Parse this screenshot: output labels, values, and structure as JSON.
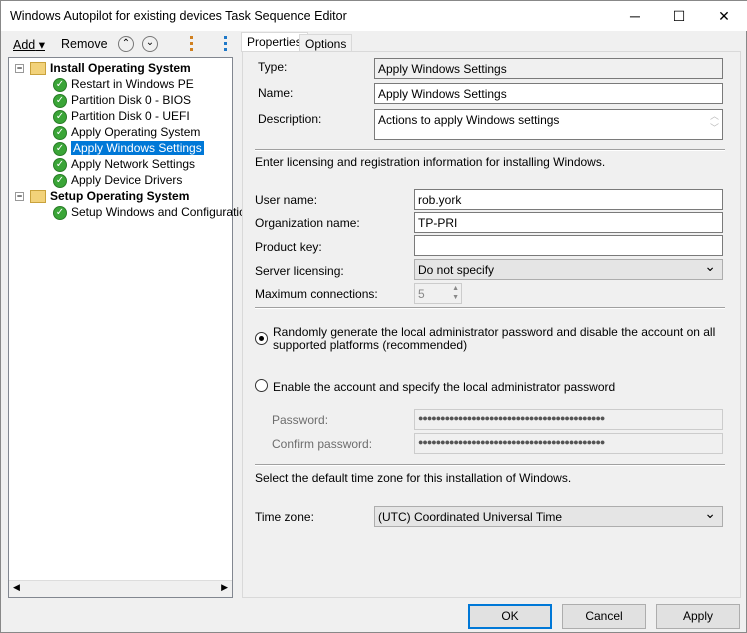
{
  "window": {
    "title": "Windows Autopilot for existing devices Task Sequence Editor",
    "minimize": "─",
    "maximize": "☐",
    "close": "✕"
  },
  "toolbar": {
    "add": "Add",
    "remove": "Remove",
    "move_up": "⌃",
    "move_down": "⌄"
  },
  "tree": {
    "groups": [
      {
        "label": "Install Operating System",
        "items": [
          "Restart in Windows PE",
          "Partition Disk 0 - BIOS",
          "Partition Disk 0 - UEFI",
          "Apply Operating System",
          "Apply Windows Settings",
          "Apply Network Settings",
          "Apply Device Drivers"
        ]
      },
      {
        "label": "Setup Operating System",
        "items": [
          "Setup Windows and Configuration"
        ]
      }
    ],
    "selected": "Apply Windows Settings"
  },
  "tabs": {
    "properties": "Properties",
    "options": "Options",
    "active": "Properties"
  },
  "form": {
    "type_label": "Type:",
    "type_value": "Apply Windows Settings",
    "name_label": "Name:",
    "name_value": "Apply Windows Settings",
    "description_label": "Description:",
    "description_value": "Actions to apply Windows settings",
    "licensing_intro": "Enter licensing and registration information for installing Windows.",
    "user_name_label": "User name:",
    "user_name_value": "rob.york",
    "org_label": "Organization name:",
    "org_value": "TP-PRI",
    "product_key_label": "Product key:",
    "product_key_value": "",
    "server_licensing_label": "Server licensing:",
    "server_licensing_value": "Do not specify",
    "max_connections_label": "Maximum connections:",
    "max_connections_value": "5",
    "radio_random": "Randomly generate the local administrator password and disable the account on all supported platforms (recommended)",
    "radio_enable": "Enable the account and specify the local administrator password",
    "radio_selected": "random",
    "password_label": "Password:",
    "password_value": "●●●●●●●●●●●●●●●●●●●●●●●●●●●●●●●●●●●●●●●●●●",
    "confirm_label": "Confirm password:",
    "confirm_value": "●●●●●●●●●●●●●●●●●●●●●●●●●●●●●●●●●●●●●●●●●●",
    "timezone_intro": "Select the default time zone for this installation of Windows.",
    "timezone_label": "Time zone:",
    "timezone_value": "(UTC) Coordinated Universal Time"
  },
  "buttons": {
    "ok": "OK",
    "cancel": "Cancel",
    "apply": "Apply"
  }
}
